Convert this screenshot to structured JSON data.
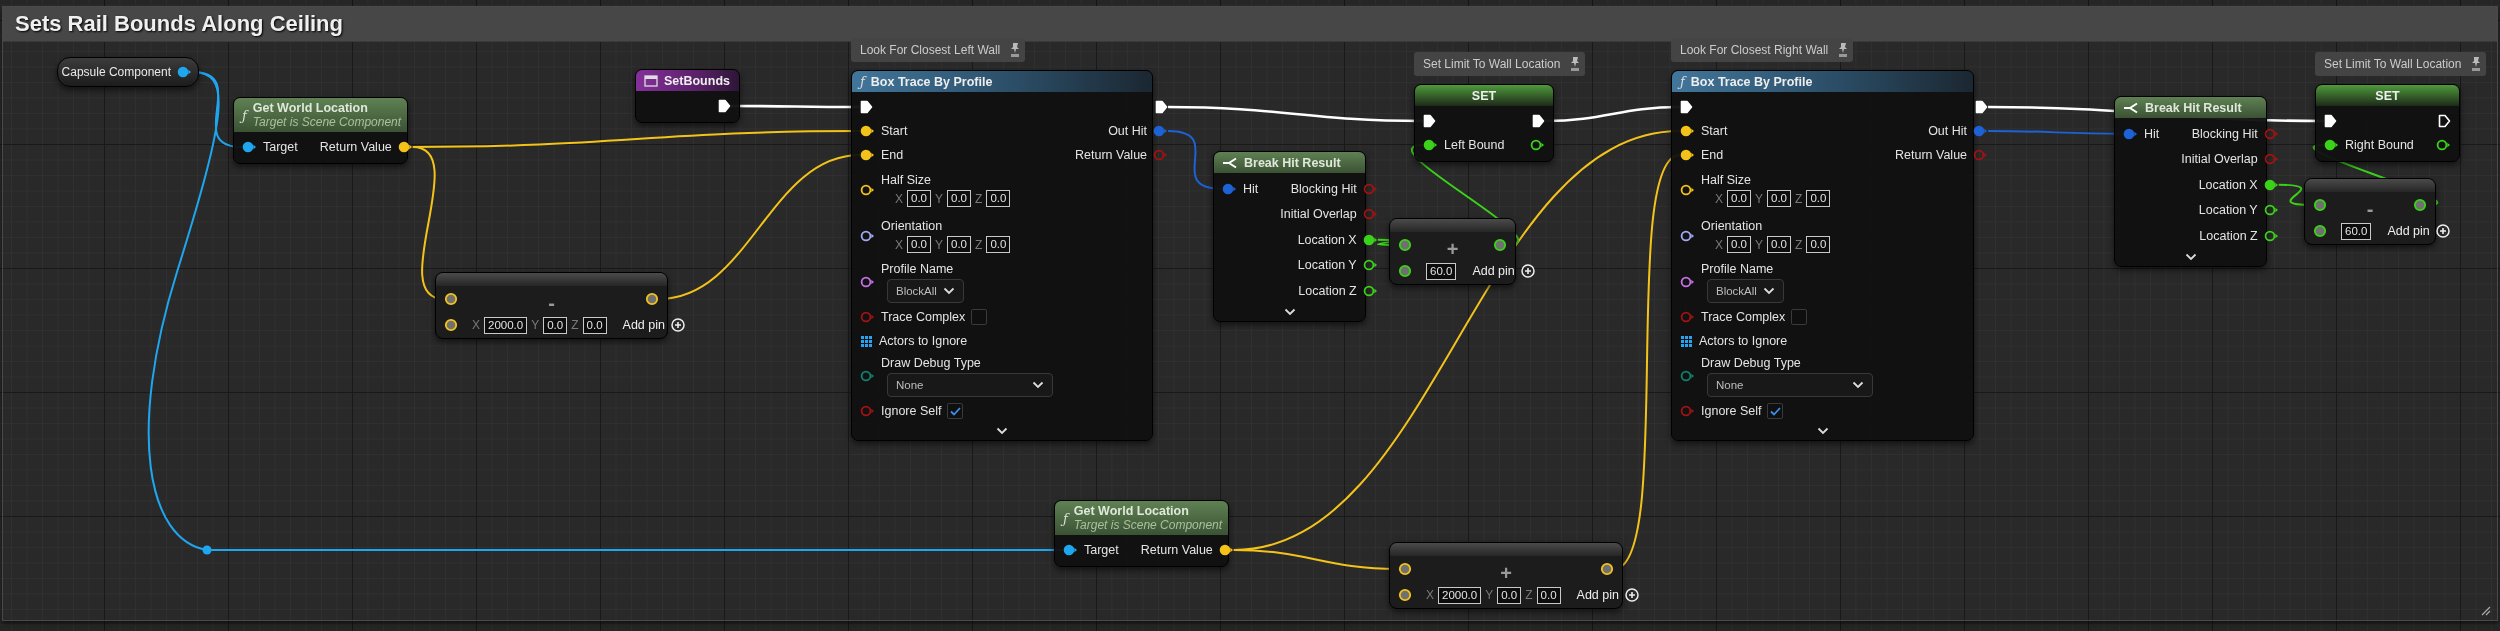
{
  "comment_box": {
    "title": "Sets Rail Bounds Along Ceiling"
  },
  "nodes": [
    {
      "kind": "variable",
      "title": "Capsule Component",
      "outputs": [
        {
          "kind": "object",
          "connected": true
        }
      ]
    },
    {
      "kind": "pure_function",
      "icon": "ƒ",
      "title": "Get World Location",
      "subtitle": "Target is Scene Component",
      "inputs": [
        {
          "label": "Target",
          "kind": "object",
          "connected": true
        }
      ],
      "outputs": [
        {
          "label": "Return Value",
          "kind": "vector",
          "connected": true
        }
      ]
    },
    {
      "kind": "event",
      "title": "SetBounds",
      "outputs": [
        {
          "kind": "exec",
          "connected": true
        }
      ]
    },
    {
      "kind": "math",
      "operator": "-",
      "inputs": [
        {
          "kind": "vector"
        },
        {
          "kind": "vector",
          "fields": [
            {
              "axis": "X",
              "value": "2000.0"
            },
            {
              "axis": "Y",
              "value": "0.0"
            },
            {
              "axis": "Z",
              "value": "0.0"
            }
          ]
        }
      ],
      "outputs": [
        {
          "kind": "vector"
        }
      ],
      "add_pin": "Add pin"
    },
    {
      "kind": "function",
      "comment": "Look For Closest Left Wall",
      "icon": "ƒ",
      "title": "Box Trace By Profile",
      "inputs": [
        {
          "kind": "exec",
          "connected": true
        },
        {
          "label": "Start",
          "kind": "vector",
          "connected": true
        },
        {
          "label": "End",
          "kind": "vector",
          "connected": true
        },
        {
          "label": "Half Size",
          "kind": "vector",
          "connected": false,
          "fields": [
            {
              "axis": "X",
              "value": "0.0"
            },
            {
              "axis": "Y",
              "value": "0.0"
            },
            {
              "axis": "Z",
              "value": "0.0"
            }
          ]
        },
        {
          "label": "Orientation",
          "kind": "rotator",
          "connected": false,
          "fields": [
            {
              "axis": "X",
              "value": "0.0"
            },
            {
              "axis": "Y",
              "value": "0.0"
            },
            {
              "axis": "Z",
              "value": "0.0"
            }
          ]
        },
        {
          "label": "Profile Name",
          "kind": "name",
          "connected": false,
          "dropdown": "BlockAll"
        },
        {
          "label": "Trace Complex",
          "kind": "bool",
          "connected": false,
          "checked": false
        },
        {
          "label": "Actors to Ignore",
          "kind": "array"
        },
        {
          "label": "Draw Debug Type",
          "kind": "enum",
          "connected": false,
          "dropdown": "None"
        },
        {
          "label": "Ignore Self",
          "kind": "bool",
          "connected": false,
          "checked": true
        }
      ],
      "outputs": [
        {
          "kind": "exec",
          "connected": true
        },
        {
          "label": "Out Hit",
          "kind": "struct",
          "connected": true
        },
        {
          "label": "Return Value",
          "kind": "bool",
          "connected": false
        }
      ],
      "expandable": true
    },
    {
      "kind": "pure_function",
      "icon": "ƒ",
      "title": "Get World Location",
      "subtitle": "Target is Scene Component",
      "inputs": [
        {
          "label": "Target",
          "kind": "object",
          "connected": true
        }
      ],
      "outputs": [
        {
          "label": "Return Value",
          "kind": "vector",
          "connected": true
        }
      ]
    },
    {
      "kind": "break",
      "title": "Break Hit Result",
      "inputs": [
        {
          "label": "Hit",
          "kind": "struct",
          "connected": true
        }
      ],
      "outputs": [
        {
          "label": "Blocking Hit",
          "kind": "bool",
          "connected": false
        },
        {
          "label": "Initial Overlap",
          "kind": "bool",
          "connected": false
        },
        {
          "label": "Location X",
          "kind": "float",
          "connected": true
        },
        {
          "label": "Location Y",
          "kind": "float",
          "connected": false
        },
        {
          "label": "Location Z",
          "kind": "float",
          "connected": false
        }
      ],
      "expandable": true
    },
    {
      "kind": "set",
      "comment": "Set Limit To Wall Location",
      "title": "SET",
      "inputs": [
        {
          "kind": "exec",
          "connected": true
        },
        {
          "label": "Left Bound",
          "kind": "float",
          "connected": true
        }
      ],
      "outputs": [
        {
          "kind": "exec",
          "connected": true
        },
        {
          "kind": "float",
          "connected": false
        }
      ]
    },
    {
      "kind": "math",
      "operator": "+",
      "inputs": [
        {
          "kind": "float"
        },
        {
          "kind": "float",
          "fields": [
            {
              "value": "60.0"
            }
          ]
        }
      ],
      "outputs": [
        {
          "kind": "float"
        }
      ],
      "add_pin": "Add pin"
    },
    {
      "kind": "math",
      "operator": "+",
      "inputs": [
        {
          "kind": "vector"
        },
        {
          "kind": "vector",
          "fields": [
            {
              "axis": "X",
              "value": "2000.0"
            },
            {
              "axis": "Y",
              "value": "0.0"
            },
            {
              "axis": "Z",
              "value": "0.0"
            }
          ]
        }
      ],
      "outputs": [
        {
          "kind": "vector"
        }
      ],
      "add_pin": "Add pin"
    },
    {
      "kind": "function",
      "comment": "Look For Closest Right Wall",
      "icon": "ƒ",
      "title": "Box Trace By Profile",
      "inputs": [
        {
          "kind": "exec",
          "connected": true
        },
        {
          "label": "Start",
          "kind": "vector",
          "connected": true
        },
        {
          "label": "End",
          "kind": "vector",
          "connected": true
        },
        {
          "label": "Half Size",
          "kind": "vector",
          "connected": false,
          "fields": [
            {
              "axis": "X",
              "value": "0.0"
            },
            {
              "axis": "Y",
              "value": "0.0"
            },
            {
              "axis": "Z",
              "value": "0.0"
            }
          ]
        },
        {
          "label": "Orientation",
          "kind": "rotator",
          "connected": false,
          "fields": [
            {
              "axis": "X",
              "value": "0.0"
            },
            {
              "axis": "Y",
              "value": "0.0"
            },
            {
              "axis": "Z",
              "value": "0.0"
            }
          ]
        },
        {
          "label": "Profile Name",
          "kind": "name",
          "connected": false,
          "dropdown": "BlockAll"
        },
        {
          "label": "Trace Complex",
          "kind": "bool",
          "connected": false,
          "checked": false
        },
        {
          "label": "Actors to Ignore",
          "kind": "array"
        },
        {
          "label": "Draw Debug Type",
          "kind": "enum",
          "connected": false,
          "dropdown": "None"
        },
        {
          "label": "Ignore Self",
          "kind": "bool",
          "connected": false,
          "checked": true
        }
      ],
      "outputs": [
        {
          "kind": "exec",
          "connected": true
        },
        {
          "label": "Out Hit",
          "kind": "struct",
          "connected": true
        },
        {
          "label": "Return Value",
          "kind": "bool",
          "connected": false
        }
      ],
      "expandable": true
    },
    {
      "kind": "break",
      "title": "Break Hit Result",
      "inputs": [
        {
          "label": "Hit",
          "kind": "struct",
          "connected": true
        }
      ],
      "outputs": [
        {
          "label": "Blocking Hit",
          "kind": "bool",
          "connected": false
        },
        {
          "label": "Initial Overlap",
          "kind": "bool",
          "connected": false
        },
        {
          "label": "Location X",
          "kind": "float",
          "connected": true
        },
        {
          "label": "Location Y",
          "kind": "float",
          "connected": false
        },
        {
          "label": "Location Z",
          "kind": "float",
          "connected": false
        }
      ],
      "expandable": true
    },
    {
      "kind": "set",
      "comment": "Set Limit To Wall Location",
      "title": "SET",
      "inputs": [
        {
          "kind": "exec",
          "connected": true
        },
        {
          "label": "Right Bound",
          "kind": "float",
          "connected": true
        }
      ],
      "outputs": [
        {
          "kind": "exec",
          "connected": false
        },
        {
          "kind": "float",
          "connected": false
        }
      ]
    },
    {
      "kind": "math",
      "operator": "-",
      "inputs": [
        {
          "kind": "float"
        },
        {
          "kind": "float",
          "fields": [
            {
              "value": "60.0"
            }
          ]
        }
      ],
      "outputs": [
        {
          "kind": "float"
        }
      ],
      "add_pin": "Add pin"
    }
  ]
}
